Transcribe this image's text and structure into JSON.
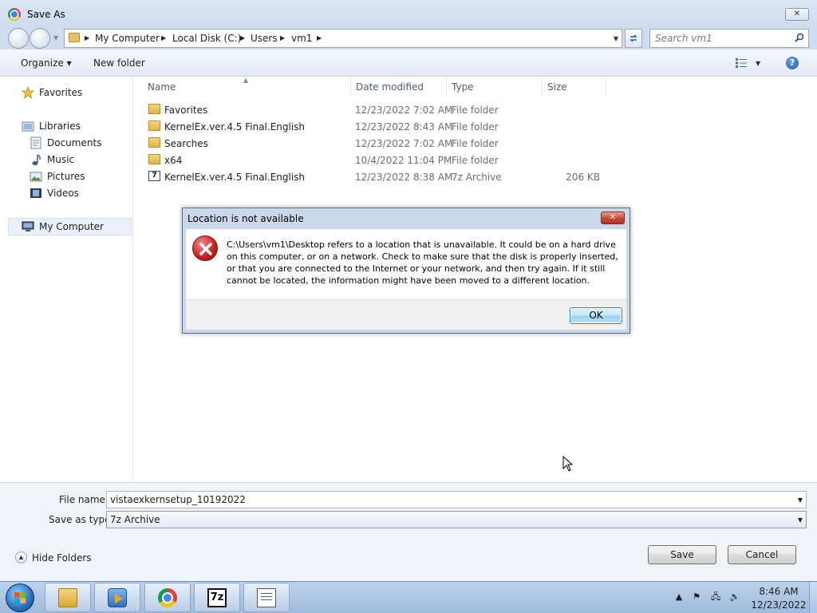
{
  "window": {
    "title": "Save As",
    "close_glyph": "✕"
  },
  "address": {
    "crumbs": [
      "My Computer",
      "Local Disk (C:)",
      "Users",
      "vm1"
    ],
    "search_placeholder": "Search vm1"
  },
  "toolbar": {
    "organize": "Organize ▾",
    "new_folder": "New folder",
    "help": "?"
  },
  "nav": {
    "favorites": "Favorites",
    "libraries": "Libraries",
    "documents": "Documents",
    "music": "Music",
    "pictures": "Pictures",
    "videos": "Videos",
    "my_computer": "My Computer"
  },
  "files": {
    "columns": [
      "Name",
      "Date modified",
      "Type",
      "Size"
    ],
    "rows": [
      {
        "name": "Favorites",
        "date": "12/23/2022 7:02 AM",
        "type": "File folder",
        "size": "",
        "icon": "folder-star-icon"
      },
      {
        "name": "KernelEx.ver.4.5 Final.English",
        "date": "12/23/2022 8:43 AM",
        "type": "File folder",
        "size": "",
        "icon": "folder-icon"
      },
      {
        "name": "Searches",
        "date": "12/23/2022 7:02 AM",
        "type": "File folder",
        "size": "",
        "icon": "folder-search-icon"
      },
      {
        "name": "x64",
        "date": "10/4/2022 11:04 PM",
        "type": "File folder",
        "size": "",
        "icon": "folder-icon"
      },
      {
        "name": "KernelEx.ver.4.5 Final.English",
        "date": "12/23/2022 8:38 AM",
        "type": "7z Archive",
        "size": "206 KB",
        "icon": "archive-7z-icon"
      }
    ]
  },
  "save": {
    "file_name_label": "File name:",
    "file_name_value": "vistaexkernsetup_10192022",
    "type_label": "Save as type:",
    "type_value": "7z Archive",
    "hide_folders": "Hide Folders",
    "save_button": "Save",
    "cancel_button": "Cancel"
  },
  "dialog": {
    "title": "Location is not available",
    "message": "C:\\Users\\vm1\\Desktop refers to a location that is unavailable. It could be on a hard drive on this computer, or on a network. Check to make sure that the disk is properly inserted, or that you are connected to the Internet or your network, and then try again. If it still cannot be located, the information might have been moved to a different location.",
    "ok_button": "OK"
  },
  "taskbar": {
    "apps": [
      "windows-explorer",
      "windows-media-player",
      "google-chrome",
      "7-zip",
      "notepad"
    ],
    "seven_zip_label": "7z",
    "time": "8:46 AM",
    "date": "12/23/2022"
  },
  "colors": {
    "titlebar": "#cfdcef",
    "dialog_close": "#c24a2f",
    "error_red": "#c81e1e"
  }
}
